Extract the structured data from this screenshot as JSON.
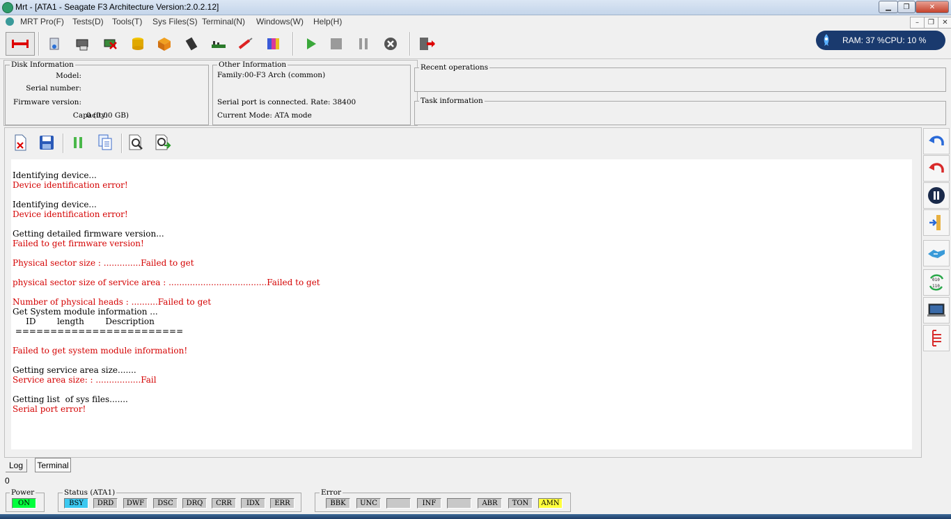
{
  "window": {
    "title": "Mrt - [ATA1 - Seagate F3 Architecture Version:2.0.2.12]",
    "minimize": "▁",
    "restore": "❐",
    "close": "✕"
  },
  "menu": [
    "MRT Pro(F)",
    "Tests(D)",
    "Tools(T)",
    "Sys Files(S)",
    "Terminal(N)",
    "Windows(W)",
    "Help(H)"
  ],
  "mdi_buttons": [
    "–",
    "❐",
    "✕"
  ],
  "resources": {
    "ram": "RAM: 37 %",
    "cpu": "CPU: 10 %"
  },
  "disk_info": {
    "legend": "Disk Information",
    "model_label": "Model:",
    "serial_label": "Serial number:",
    "firmware_label": "Firmware version:",
    "capacity_label": "Capacity:",
    "capacity_value": "0 (0.00 GB)"
  },
  "other_info": {
    "legend": "Other Information",
    "family": "Family:00-F3 Arch (common)",
    "serial_port": "Serial port is connected. Rate: 38400",
    "mode": "Current Mode: ATA mode"
  },
  "recent": {
    "legend": "Recent operations"
  },
  "task": {
    "legend": "Task information"
  },
  "log": [
    {
      "text": "Identifying device...",
      "error": false
    },
    {
      "text": "Device identification error!",
      "error": true
    },
    {
      "text": "",
      "error": false
    },
    {
      "text": "Identifying device...",
      "error": false
    },
    {
      "text": "Device identification error!",
      "error": true
    },
    {
      "text": "",
      "error": false
    },
    {
      "text": "Getting detailed firmware version...",
      "error": false
    },
    {
      "text": "Failed to get firmware version!",
      "error": true
    },
    {
      "text": "",
      "error": false
    },
    {
      "text": "Physical sector size : ..............Failed to get",
      "error": true
    },
    {
      "text": "",
      "error": false
    },
    {
      "text": "physical sector size of service area : .....................................Failed to get",
      "error": true
    },
    {
      "text": "",
      "error": false
    },
    {
      "text": "Number of physical heads : ..........Failed to get",
      "error": true
    },
    {
      "text": "Get System module information ...",
      "error": false
    },
    {
      "text": "     ID        length        Description",
      "error": false
    },
    {
      "text": " ========================",
      "error": false
    },
    {
      "text": "",
      "error": false
    },
    {
      "text": "Failed to get system module information!",
      "error": true
    },
    {
      "text": "",
      "error": false
    },
    {
      "text": "Getting service area size.......",
      "error": false
    },
    {
      "text": "Service area size: : .................Fail",
      "error": true
    },
    {
      "text": "",
      "error": false
    },
    {
      "text": "Getting list  of sys files.......",
      "error": false
    },
    {
      "text": "Serial port error!",
      "error": true
    }
  ],
  "tabs": {
    "log": "Log",
    "terminal": "Terminal"
  },
  "status_line": "0",
  "power": {
    "legend": "Power",
    "on": "ON"
  },
  "status": {
    "legend": "Status (ATA1)",
    "flags": [
      "BSY",
      "DRD",
      "DWF",
      "DSC",
      "DRQ",
      "CRR",
      "IDX",
      "ERR"
    ]
  },
  "error": {
    "legend": "Error",
    "flags": [
      "BBK",
      "UNC",
      "",
      "INF",
      "",
      "ABR",
      "TON",
      "AMN"
    ]
  },
  "colors": {
    "on_green": "#00ff3c",
    "bsy_cyan": "#3cc8f0",
    "amn_yellow": "#ffff3c",
    "flag_gray": "#c8c8c8",
    "error_red": "#d40000"
  }
}
